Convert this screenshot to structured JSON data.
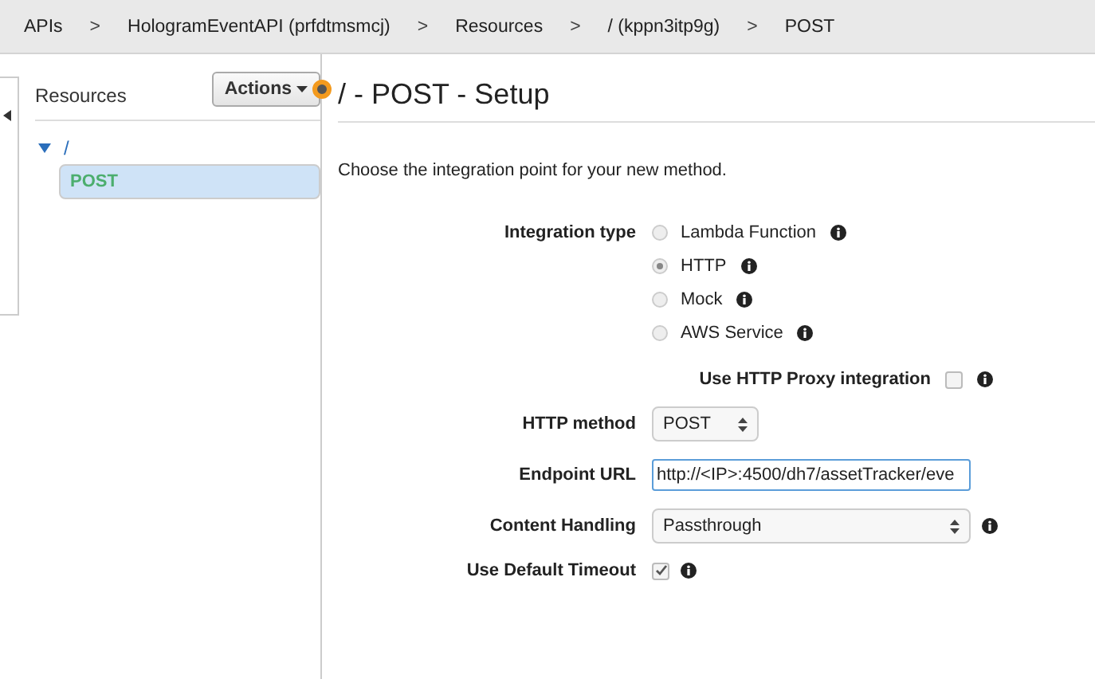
{
  "breadcrumb": [
    {
      "kind": "link",
      "label": "APIs"
    },
    {
      "kind": "separator",
      "label": ">"
    },
    {
      "kind": "link",
      "label": "HologramEventAPI (prfdtmsmcj)"
    },
    {
      "kind": "separator",
      "label": ">"
    },
    {
      "kind": "link",
      "label": "Resources"
    },
    {
      "kind": "separator",
      "label": ">"
    },
    {
      "kind": "link",
      "label": "/ (kppn3itp9g)"
    },
    {
      "kind": "separator",
      "label": ">"
    },
    {
      "kind": "link",
      "label": "POST"
    }
  ],
  "sidebar": {
    "title": "Resources",
    "actions_button": "Actions",
    "tree": [
      {
        "label": "/",
        "expanded": true,
        "selected": false,
        "children": [
          {
            "label": "POST",
            "selected": true
          }
        ]
      }
    ]
  },
  "page_title": "/ - POST - Setup",
  "intro": "Choose the integration point for your new method.",
  "integration_type": {
    "label": "Integration type",
    "options": [
      {
        "label": "Lambda Function",
        "selected": false
      },
      {
        "label": "HTTP",
        "selected": true
      },
      {
        "label": "Mock",
        "selected": false
      },
      {
        "label": "AWS Service",
        "selected": false
      }
    ]
  },
  "proxy": {
    "label": "Use HTTP Proxy integration",
    "checked": false
  },
  "http_method": {
    "label": "HTTP method",
    "value": "POST"
  },
  "endpoint_url": {
    "label": "Endpoint URL",
    "value": "http://<IP>:4500/dh7/assetTracker/eve"
  },
  "content_handling": {
    "label": "Content Handling",
    "value": "Passthrough"
  },
  "default_timeout": {
    "label": "Use Default Timeout",
    "checked": true
  }
}
